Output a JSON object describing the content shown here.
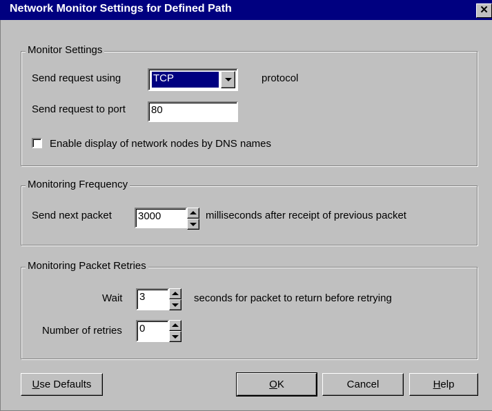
{
  "window": {
    "title": "Network Monitor Settings for Defined Path",
    "close_glyph": "✕"
  },
  "monitor_settings": {
    "legend": "Monitor Settings",
    "send_using_label": "Send request using",
    "protocol_value": "TCP",
    "protocol_suffix": "protocol",
    "port_label": "Send request to port",
    "port_value": "80",
    "dns_checkbox_label": "Enable display of network nodes by DNS names",
    "dns_checked": false
  },
  "frequency": {
    "legend": "Monitoring Frequency",
    "send_next_label": "Send next packet",
    "interval_value": "3000",
    "interval_suffix": "milliseconds after receipt of previous packet"
  },
  "retries": {
    "legend": "Monitoring Packet Retries",
    "wait_label": "Wait",
    "wait_value": "3",
    "wait_suffix": "seconds for packet to return before retrying",
    "retries_label": "Number of retries",
    "retries_value": "0"
  },
  "buttons": {
    "defaults_mnemonic": "U",
    "defaults_rest": "se Defaults",
    "ok_mnemonic": "O",
    "ok_rest": "K",
    "cancel": "Cancel",
    "help_mnemonic": "H",
    "help_rest": "elp"
  },
  "colors": {
    "titlebar": "#000080",
    "dialog_bg": "#c0c0c0",
    "selection": "#000080"
  }
}
